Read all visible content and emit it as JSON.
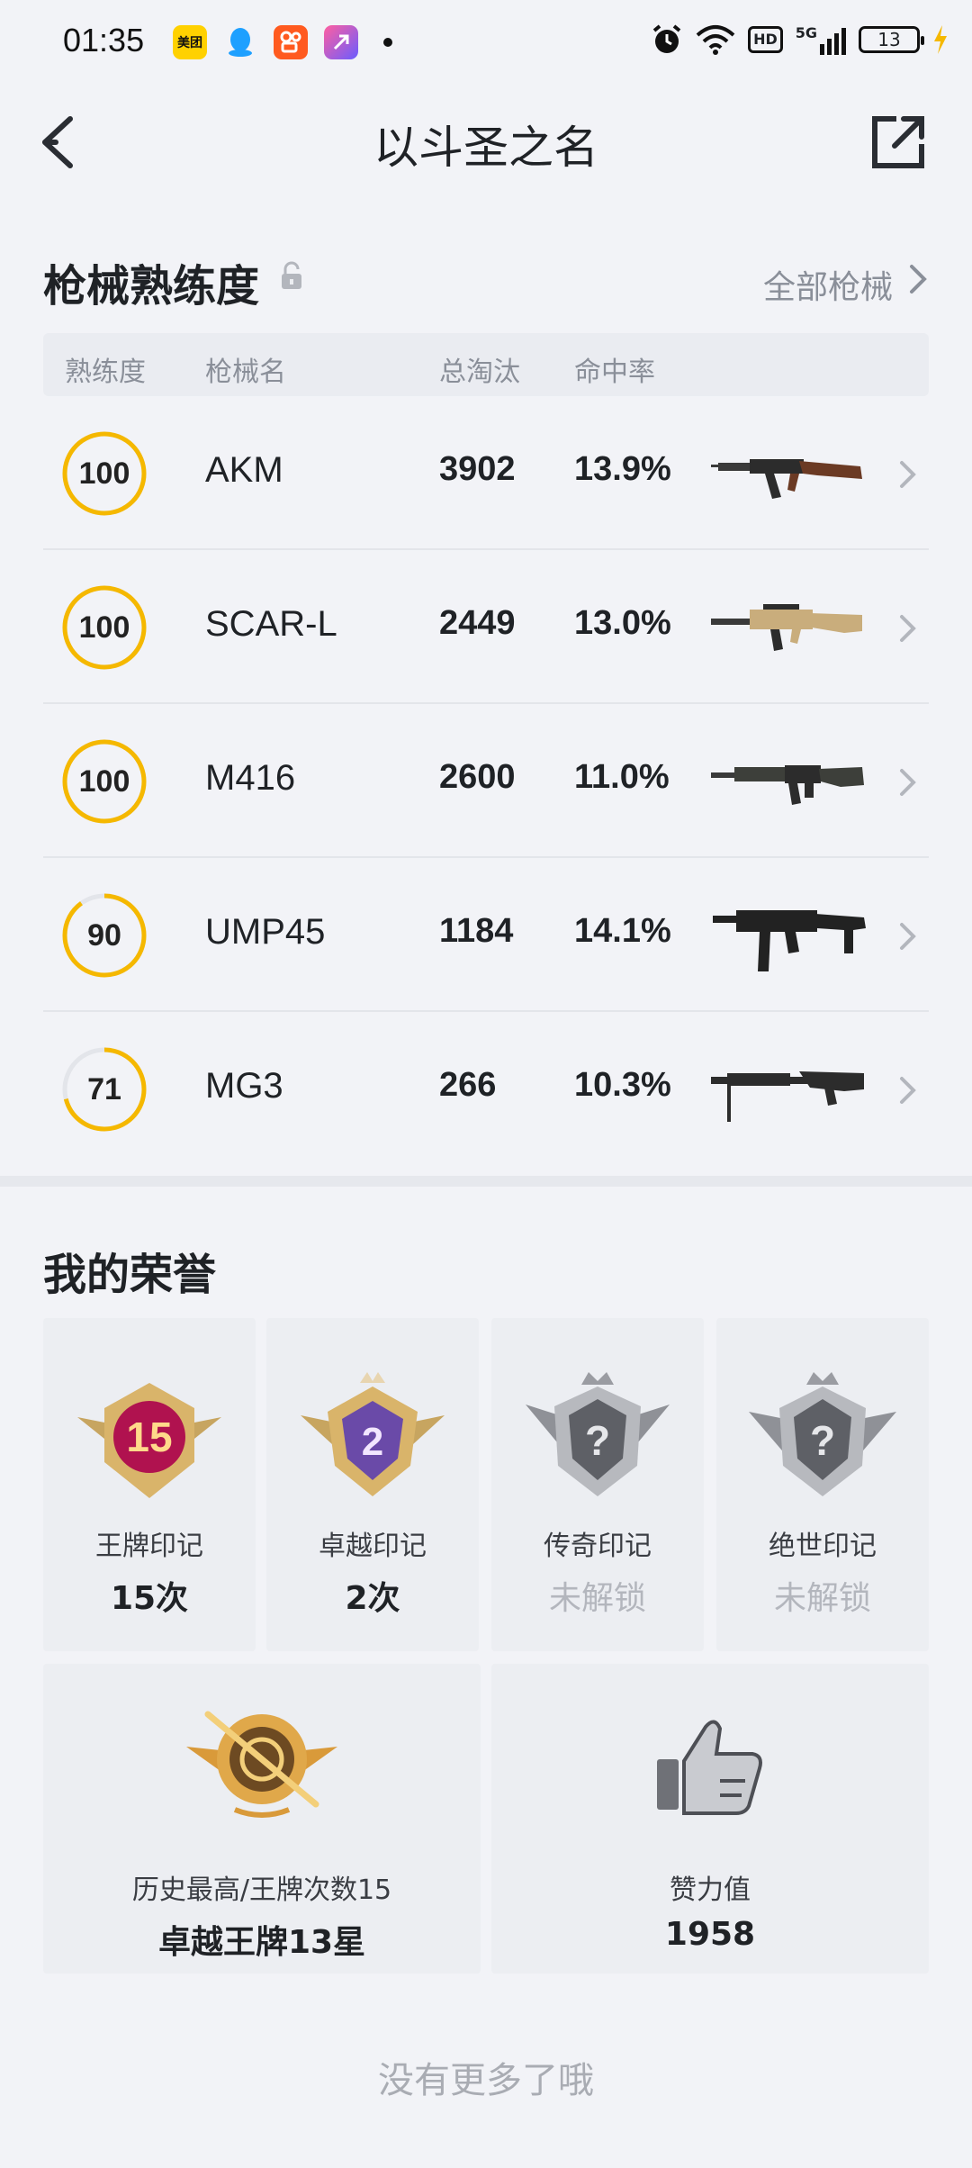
{
  "status_bar": {
    "time": "01:35",
    "apps": [
      {
        "icon": "meituan-app-icon",
        "label": "美团",
        "color": "#ffd100"
      },
      {
        "icon": "qq-app-icon",
        "label": "",
        "color": "#1ea0ff"
      },
      {
        "icon": "kuaishou-app-icon",
        "label": "",
        "color": "#ff5a1f"
      },
      {
        "icon": "shortcut-app-icon",
        "label": "",
        "color": "#6b5cff"
      }
    ],
    "hd": "HD",
    "network": "5G",
    "battery": "13"
  },
  "header": {
    "title": "以斗圣之名"
  },
  "weapons": {
    "section_title": "枪械熟练度",
    "all_link": "全部枪械",
    "columns": [
      "熟练度",
      "枪械名",
      "总淘汰",
      "命中率"
    ],
    "rows": [
      {
        "proficiency": 100,
        "name": "AKM",
        "kills": "3902",
        "hit_rate": "13.9%",
        "gun": "akm-gun-image"
      },
      {
        "proficiency": 100,
        "name": "SCAR-L",
        "kills": "2449",
        "hit_rate": "13.0%",
        "gun": "scar-l-gun-image"
      },
      {
        "proficiency": 100,
        "name": "M416",
        "kills": "2600",
        "hit_rate": "11.0%",
        "gun": "m416-gun-image"
      },
      {
        "proficiency": 90,
        "name": "UMP45",
        "kills": "1184",
        "hit_rate": "14.1%",
        "gun": "ump45-gun-image"
      },
      {
        "proficiency": 71,
        "name": "MG3",
        "kills": "266",
        "hit_rate": "10.3%",
        "gun": "mg3-gun-image"
      }
    ],
    "ring_color": "#f5b800",
    "ring_track_color": "#e3e5ea"
  },
  "honor": {
    "section_title": "我的荣誉",
    "badges": [
      {
        "label": "王牌印记",
        "value": "15次",
        "badge_text": "15",
        "locked": false,
        "icon": "ace-mark-badge-icon"
      },
      {
        "label": "卓越印记",
        "value": "2次",
        "badge_text": "2",
        "locked": false,
        "icon": "excellence-mark-badge-icon"
      },
      {
        "label": "传奇印记",
        "value": "未解锁",
        "badge_text": "?",
        "locked": true,
        "icon": "legend-mark-badge-icon"
      },
      {
        "label": "绝世印记",
        "value": "未解锁",
        "badge_text": "?",
        "locked": true,
        "icon": "peerless-mark-badge-icon"
      }
    ],
    "highest": {
      "label": "历史最高/王牌次数15",
      "value": "卓越王牌13星",
      "icon": "rank-emblem-icon"
    },
    "likes": {
      "label": "赞力值",
      "value": "1958",
      "icon": "thumbs-up-icon"
    }
  },
  "footer": {
    "no_more": "没有更多了哦"
  }
}
